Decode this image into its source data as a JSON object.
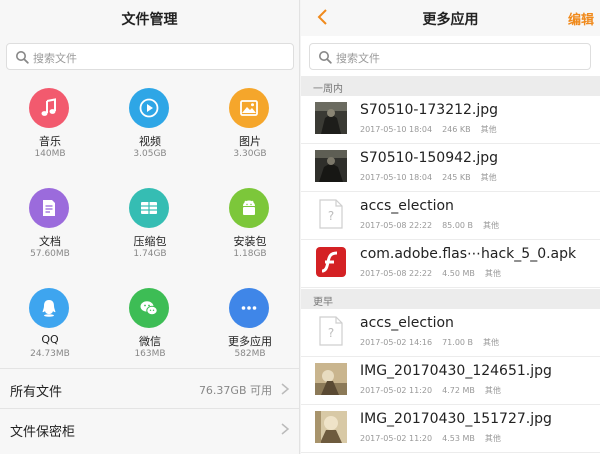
{
  "left": {
    "title": "文件管理",
    "search_placeholder": "搜索文件",
    "categories": [
      {
        "name": "音乐",
        "size": "140MB",
        "icon": "music-icon",
        "color": "#f25a6e"
      },
      {
        "name": "视频",
        "size": "3.05GB",
        "icon": "video-icon",
        "color": "#2ea6e6"
      },
      {
        "name": "图片",
        "size": "3.30GB",
        "icon": "image-icon",
        "color": "#f5a62b"
      },
      {
        "name": "文档",
        "size": "57.60MB",
        "icon": "document-icon",
        "color": "#9b6bdc"
      },
      {
        "name": "压缩包",
        "size": "1.74GB",
        "icon": "archive-icon",
        "color": "#35bdb3"
      },
      {
        "name": "安装包",
        "size": "1.18GB",
        "icon": "android-icon",
        "color": "#7cc73a"
      },
      {
        "name": "QQ",
        "size": "24.73MB",
        "icon": "qq-icon",
        "color": "#3ea5ef"
      },
      {
        "name": "微信",
        "size": "163MB",
        "icon": "wechat-icon",
        "color": "#3dbd55"
      },
      {
        "name": "更多应用",
        "size": "582MB",
        "icon": "more-icon",
        "color": "#3f86e8"
      }
    ],
    "all_files_label": "所有文件",
    "all_files_value": "76.37GB 可用",
    "vault_label": "文件保密柜"
  },
  "right": {
    "title": "更多应用",
    "edit_label": "编辑",
    "search_placeholder": "搜索文件",
    "sections": [
      {
        "label": "一周内",
        "files": [
          {
            "name": "S70510-173212.jpg",
            "date": "2017-05-10 18:04",
            "size": "246 KB",
            "type": "其他",
            "thumb": "photo-dark-thumbnail"
          },
          {
            "name": "S70510-150942.jpg",
            "date": "2017-05-10 18:04",
            "size": "245 KB",
            "type": "其他",
            "thumb": "photo-dark-thumbnail"
          },
          {
            "name": "accs_election",
            "date": "2017-05-08 22:22",
            "size": "85.00 B",
            "type": "其他",
            "thumb": "unknown-file-icon"
          },
          {
            "name": "com.adobe.flas⋯hack_5_0.apk",
            "date": "2017-05-08 22:22",
            "size": "4.50 MB",
            "type": "其他",
            "thumb": "flash-app-icon"
          }
        ]
      },
      {
        "label": "更早",
        "files": [
          {
            "name": "accs_election",
            "date": "2017-05-02 14:16",
            "size": "71.00 B",
            "type": "其他",
            "thumb": "unknown-file-icon"
          },
          {
            "name": "IMG_20170430_124651.jpg",
            "date": "2017-05-02 11:20",
            "size": "4.72 MB",
            "type": "其他",
            "thumb": "photo-light-thumbnail"
          },
          {
            "name": "IMG_20170430_151727.jpg",
            "date": "2017-05-02 11:20",
            "size": "4.53 MB",
            "type": "其他",
            "thumb": "photo-light-thumbnail"
          }
        ]
      }
    ]
  }
}
